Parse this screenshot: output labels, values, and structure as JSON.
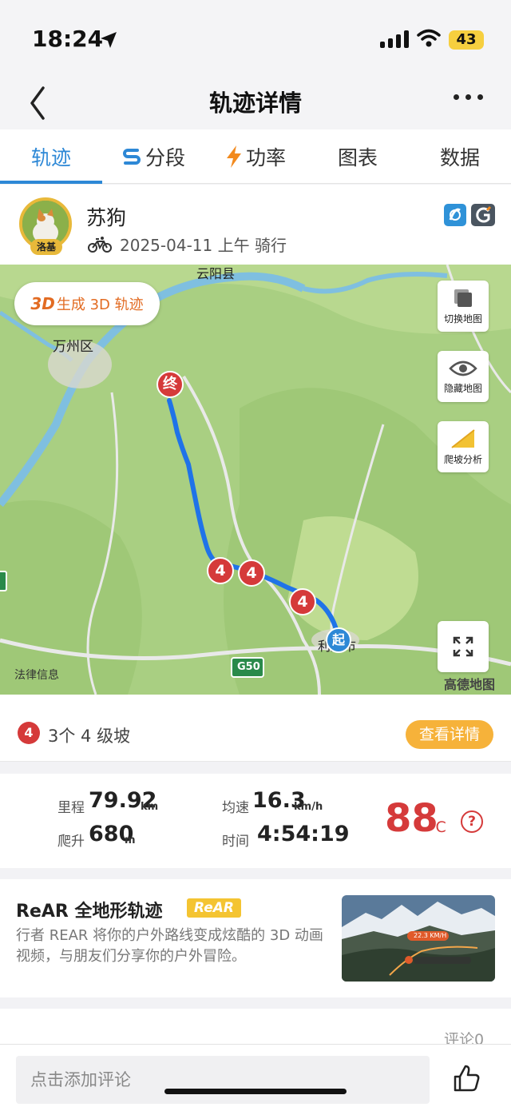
{
  "status_bar": {
    "time": "18:24",
    "battery": "43"
  },
  "nav": {
    "title": "轨迹详情"
  },
  "tabs": [
    {
      "label": "轨迹"
    },
    {
      "label": "分段"
    },
    {
      "label": "功率"
    },
    {
      "label": "图表"
    },
    {
      "label": "数据"
    }
  ],
  "user": {
    "name": "苏狗",
    "avatar_tag": "洛基",
    "meta": "2025-04-11 上午 骑行"
  },
  "map": {
    "btn_3d_prefix": "3D",
    "btn_3d_label": "生成 3D 轨迹",
    "switch_label": "切换地图",
    "hide_label": "隐藏地图",
    "climb_label": "爬坡分析",
    "place_yunyang": "云阳县",
    "place_wanzhou": "万州区",
    "place_city": "利川市",
    "road": "G50",
    "end_marker": "终",
    "start_marker": "起",
    "climb_marker": "4",
    "legal": "法律信息",
    "provider": "高德地图"
  },
  "climbs": {
    "badge": "4",
    "text": "3个 4 级坡",
    "button": "查看详情"
  },
  "stats": {
    "distance_label": "里程",
    "distance": "79.92",
    "distance_unit": "km",
    "speed_label": "均速",
    "speed": "16.3",
    "speed_unit": "km/h",
    "climb_label": "爬升",
    "climb": "680",
    "climb_unit": "m",
    "time_label": "时间",
    "time": "4:54:19",
    "temperature": "88",
    "temperature_unit": "°C",
    "help": "?"
  },
  "rear": {
    "title": "ReAR 全地形轨迹",
    "badge": "ReAR",
    "description": "行者 REAR 将你的户外路线变成炫酷的 3D 动画视频，与朋友们分享你的户外冒险。",
    "thumb_speed": "22.3 KM/H"
  },
  "comments": {
    "count": "评论0",
    "placeholder": "点击添加评论"
  }
}
